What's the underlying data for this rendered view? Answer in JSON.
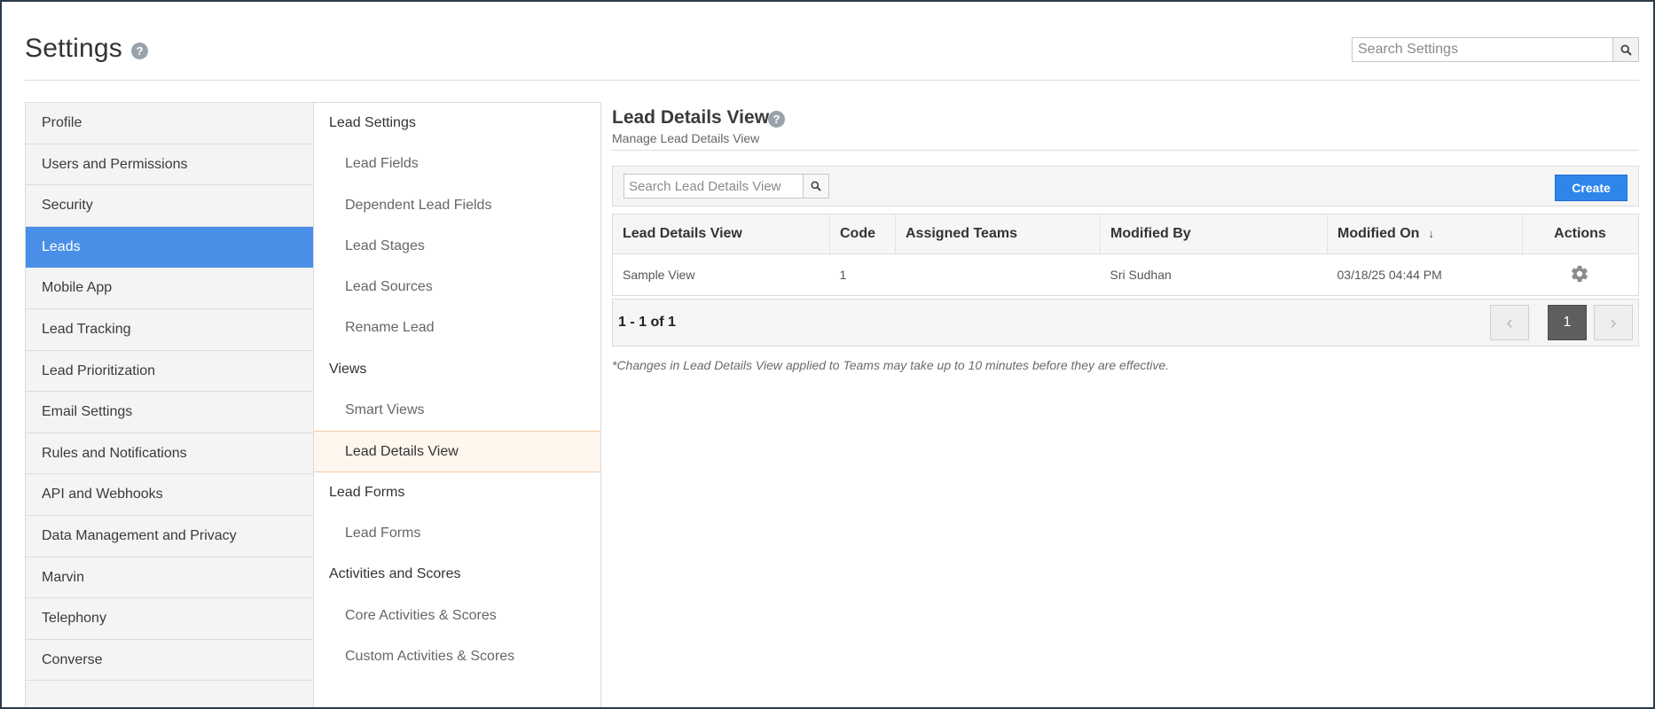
{
  "header": {
    "title": "Settings",
    "search_placeholder": "Search Settings"
  },
  "nav_primary": {
    "items": [
      {
        "label": "Profile"
      },
      {
        "label": "Users and Permissions"
      },
      {
        "label": "Security"
      },
      {
        "label": "Leads",
        "active": true
      },
      {
        "label": "Mobile App"
      },
      {
        "label": "Lead Tracking"
      },
      {
        "label": "Lead Prioritization"
      },
      {
        "label": "Email Settings"
      },
      {
        "label": "Rules and Notifications"
      },
      {
        "label": "API and Webhooks"
      },
      {
        "label": "Data Management and Privacy"
      },
      {
        "label": "Marvin"
      },
      {
        "label": "Telephony"
      },
      {
        "label": "Converse"
      }
    ]
  },
  "nav_secondary": {
    "groups": [
      {
        "header": "Lead Settings",
        "items": [
          "Lead Fields",
          "Dependent Lead Fields",
          "Lead Stages",
          "Lead Sources",
          "Rename Lead"
        ]
      },
      {
        "header": "Views",
        "items": [
          "Smart Views",
          "Lead Details View"
        ]
      },
      {
        "header": "Lead Forms",
        "items": [
          "Lead Forms"
        ]
      },
      {
        "header": "Activities and Scores",
        "items": [
          "Core Activities & Scores",
          "Custom Activities & Scores"
        ]
      }
    ],
    "active_item": "Lead Details View"
  },
  "content": {
    "title": "Lead Details View",
    "subtitle": "Manage Lead Details View",
    "search_placeholder": "Search Lead Details View",
    "create_label": "Create",
    "table": {
      "columns": [
        "Lead Details View",
        "Code",
        "Assigned Teams",
        "Modified By",
        "Modified On",
        "Actions"
      ],
      "sort_indicator": "↓",
      "rows": [
        {
          "name": "Sample View",
          "code": "1",
          "teams": "",
          "modified_by": "Sri Sudhan",
          "modified_on": "03/18/25 04:44 PM",
          "action_icon": "gear-icon"
        }
      ]
    },
    "pagination": {
      "summary": "1 - 1 of 1",
      "current_page": "1"
    },
    "note": "*Changes in Lead Details View applied to Teams may take up to 10 minutes before they are effective."
  },
  "colors": {
    "accent": "#4a8fe7",
    "create_button": "#2f86ea",
    "active_secondary_bg": "#fff6ee"
  }
}
